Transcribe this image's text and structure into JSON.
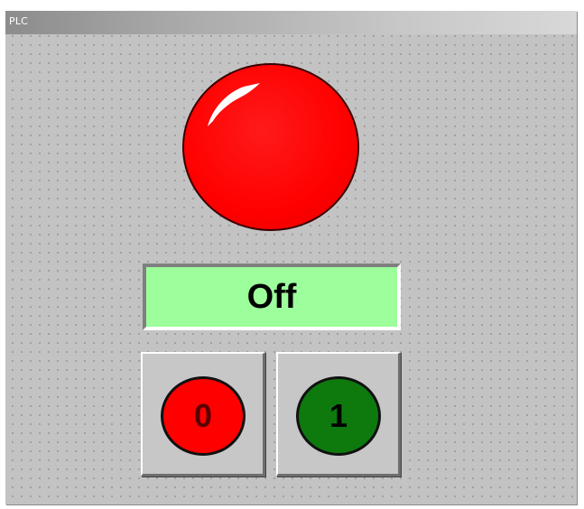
{
  "window": {
    "title": "PLC"
  },
  "lamp": {
    "state": "off",
    "color": "#ff0000"
  },
  "status": {
    "text": "Off",
    "background": "#9cff9c"
  },
  "buttons": {
    "off": {
      "label": "0",
      "color": "#ff0000"
    },
    "on": {
      "label": "1",
      "color": "#0e7a0e"
    }
  }
}
